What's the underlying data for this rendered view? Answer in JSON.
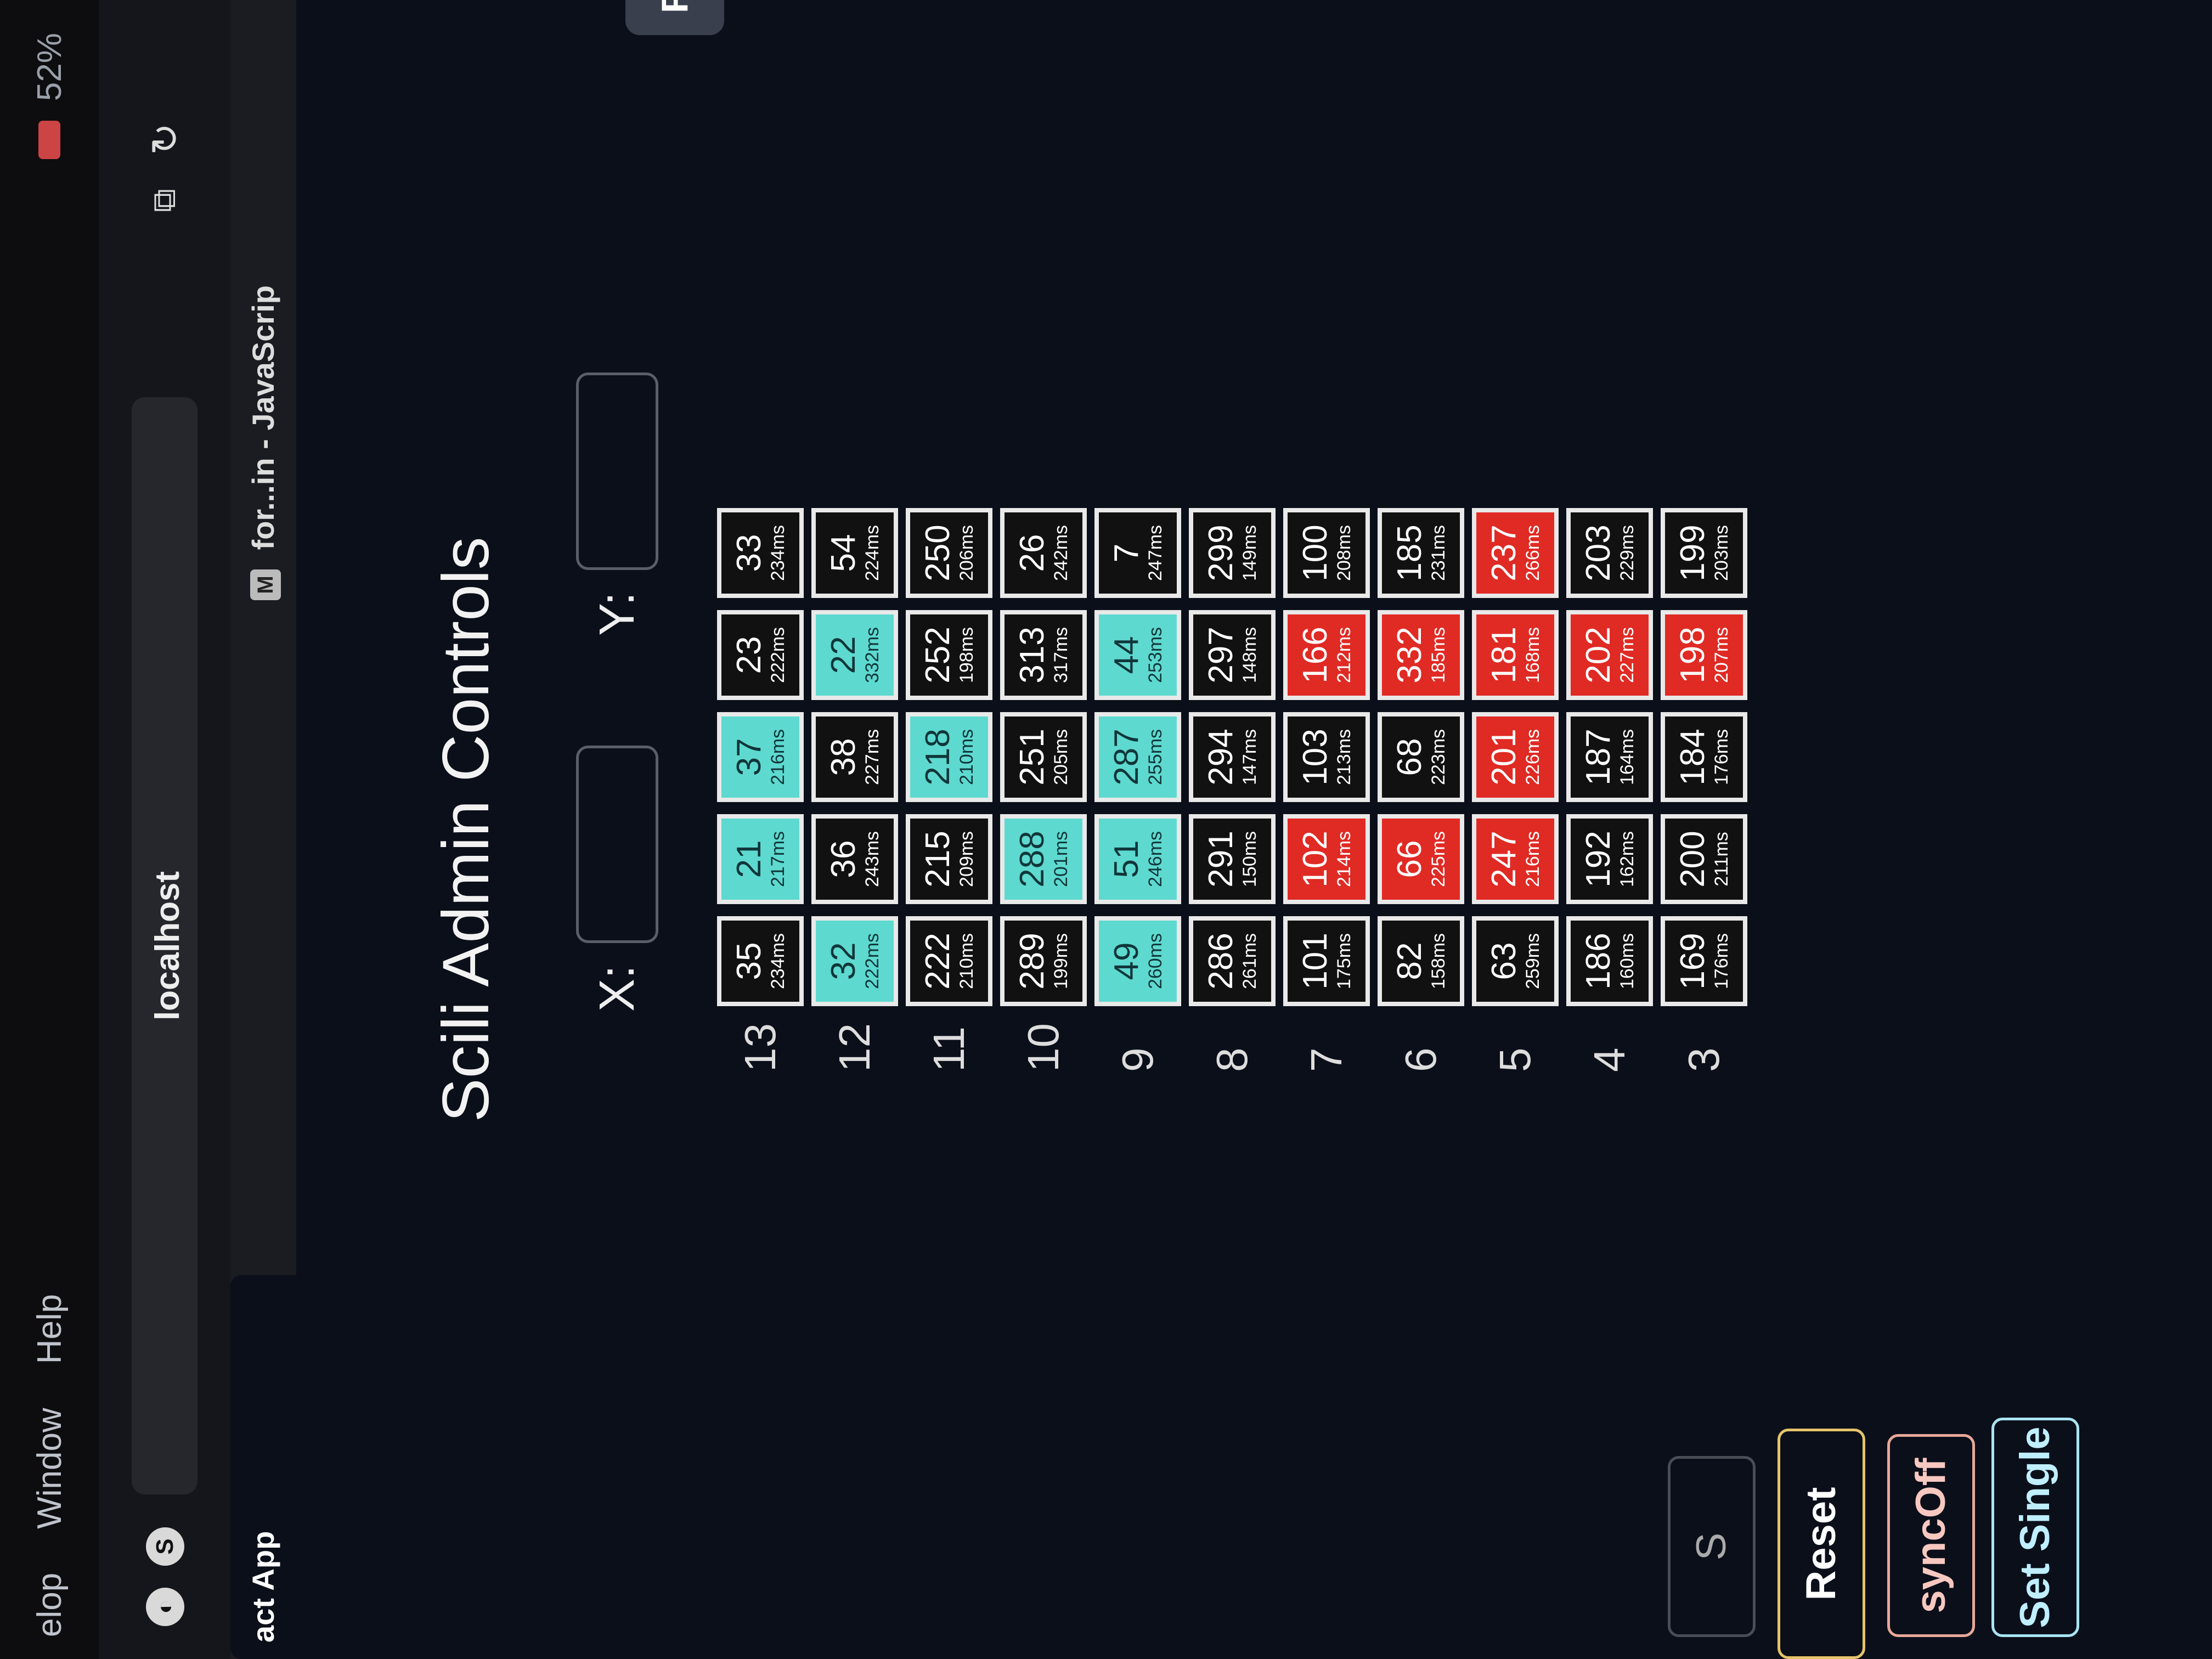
{
  "menubar": {
    "items": [
      "elop",
      "Window",
      "Help"
    ],
    "battery": "52%"
  },
  "browser": {
    "url": "localhost",
    "tabs": [
      {
        "label": "act App"
      },
      {
        "label": "for...in - JavaScrip",
        "favicon": "M"
      }
    ],
    "nav_icon_label": "S"
  },
  "page": {
    "title": "Scili Admin Controls",
    "refresh_label": "Ref",
    "x_label": "X:",
    "y_label": "Y:",
    "x_value": "",
    "y_value": ""
  },
  "colors": {
    "black": "#111111",
    "cyan": "#5ed9cf",
    "red": "#e02a24",
    "background": "#0b0f1a"
  },
  "grid": [
    {
      "row": "13",
      "cells": [
        {
          "v": "35",
          "ms": "234ms",
          "c": "black"
        },
        {
          "v": "21",
          "ms": "217ms",
          "c": "cyan"
        },
        {
          "v": "37",
          "ms": "216ms",
          "c": "cyan"
        },
        {
          "v": "23",
          "ms": "222ms",
          "c": "black"
        },
        {
          "v": "33",
          "ms": "234ms",
          "c": "black"
        }
      ]
    },
    {
      "row": "12",
      "cells": [
        {
          "v": "32",
          "ms": "222ms",
          "c": "cyan"
        },
        {
          "v": "36",
          "ms": "243ms",
          "c": "black"
        },
        {
          "v": "38",
          "ms": "227ms",
          "c": "black"
        },
        {
          "v": "22",
          "ms": "332ms",
          "c": "cyan"
        },
        {
          "v": "54",
          "ms": "224ms",
          "c": "black"
        }
      ]
    },
    {
      "row": "11",
      "cells": [
        {
          "v": "222",
          "ms": "210ms",
          "c": "black"
        },
        {
          "v": "215",
          "ms": "209ms",
          "c": "black"
        },
        {
          "v": "218",
          "ms": "210ms",
          "c": "cyan"
        },
        {
          "v": "252",
          "ms": "198ms",
          "c": "black"
        },
        {
          "v": "250",
          "ms": "206ms",
          "c": "black"
        }
      ]
    },
    {
      "row": "10",
      "cells": [
        {
          "v": "289",
          "ms": "199ms",
          "c": "black"
        },
        {
          "v": "288",
          "ms": "201ms",
          "c": "cyan"
        },
        {
          "v": "251",
          "ms": "205ms",
          "c": "black"
        },
        {
          "v": "313",
          "ms": "317ms",
          "c": "black"
        },
        {
          "v": "26",
          "ms": "242ms",
          "c": "black"
        }
      ]
    },
    {
      "row": "9",
      "cells": [
        {
          "v": "49",
          "ms": "260ms",
          "c": "cyan"
        },
        {
          "v": "51",
          "ms": "246ms",
          "c": "cyan"
        },
        {
          "v": "287",
          "ms": "255ms",
          "c": "cyan"
        },
        {
          "v": "44",
          "ms": "253ms",
          "c": "cyan"
        },
        {
          "v": "7",
          "ms": "247ms",
          "c": "black"
        }
      ]
    },
    {
      "row": "8",
      "cells": [
        {
          "v": "286",
          "ms": "261ms",
          "c": "black"
        },
        {
          "v": "291",
          "ms": "150ms",
          "c": "black"
        },
        {
          "v": "294",
          "ms": "147ms",
          "c": "black"
        },
        {
          "v": "297",
          "ms": "148ms",
          "c": "black"
        },
        {
          "v": "299",
          "ms": "149ms",
          "c": "black"
        }
      ]
    },
    {
      "row": "7",
      "cells": [
        {
          "v": "101",
          "ms": "175ms",
          "c": "black"
        },
        {
          "v": "102",
          "ms": "214ms",
          "c": "red"
        },
        {
          "v": "103",
          "ms": "213ms",
          "c": "black"
        },
        {
          "v": "166",
          "ms": "212ms",
          "c": "red"
        },
        {
          "v": "100",
          "ms": "208ms",
          "c": "black"
        }
      ]
    },
    {
      "row": "6",
      "cells": [
        {
          "v": "82",
          "ms": "158ms",
          "c": "black"
        },
        {
          "v": "66",
          "ms": "225ms",
          "c": "red"
        },
        {
          "v": "68",
          "ms": "223ms",
          "c": "black"
        },
        {
          "v": "332",
          "ms": "185ms",
          "c": "red"
        },
        {
          "v": "185",
          "ms": "231ms",
          "c": "black"
        }
      ]
    },
    {
      "row": "5",
      "cells": [
        {
          "v": "63",
          "ms": "259ms",
          "c": "black"
        },
        {
          "v": "247",
          "ms": "216ms",
          "c": "red"
        },
        {
          "v": "201",
          "ms": "226ms",
          "c": "red"
        },
        {
          "v": "181",
          "ms": "168ms",
          "c": "red"
        },
        {
          "v": "237",
          "ms": "266ms",
          "c": "red"
        }
      ]
    },
    {
      "row": "4",
      "cells": [
        {
          "v": "186",
          "ms": "160ms",
          "c": "black"
        },
        {
          "v": "192",
          "ms": "162ms",
          "c": "black"
        },
        {
          "v": "187",
          "ms": "164ms",
          "c": "black"
        },
        {
          "v": "202",
          "ms": "227ms",
          "c": "red"
        },
        {
          "v": "203",
          "ms": "229ms",
          "c": "black"
        }
      ]
    },
    {
      "row": "3",
      "cells": [
        {
          "v": "169",
          "ms": "176ms",
          "c": "black"
        },
        {
          "v": "200",
          "ms": "211ms",
          "c": "black"
        },
        {
          "v": "184",
          "ms": "176ms",
          "c": "black"
        },
        {
          "v": "198",
          "ms": "207ms",
          "c": "red"
        },
        {
          "v": "199",
          "ms": "203ms",
          "c": "black"
        }
      ]
    }
  ],
  "controls": {
    "s_label": "S",
    "reset_label": "Reset",
    "sync_label": "syncOff",
    "single_label": "Set Single"
  }
}
